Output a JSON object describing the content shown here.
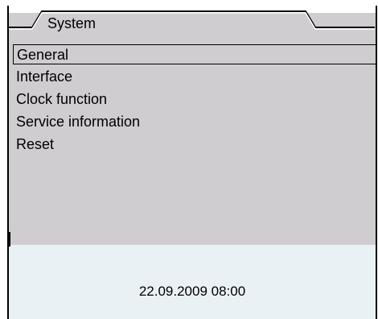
{
  "header": {
    "title": "System"
  },
  "menu": {
    "items": [
      {
        "label": "General",
        "selected": true
      },
      {
        "label": "Interface",
        "selected": false
      },
      {
        "label": "Clock function",
        "selected": false
      },
      {
        "label": "Service information",
        "selected": false
      },
      {
        "label": "Reset",
        "selected": false
      }
    ]
  },
  "status": {
    "datetime": "22.09.2009 08:00"
  },
  "colors": {
    "panel": "#cfcdcf",
    "status_bar": "#eaf1f5",
    "frame": "#000000"
  }
}
